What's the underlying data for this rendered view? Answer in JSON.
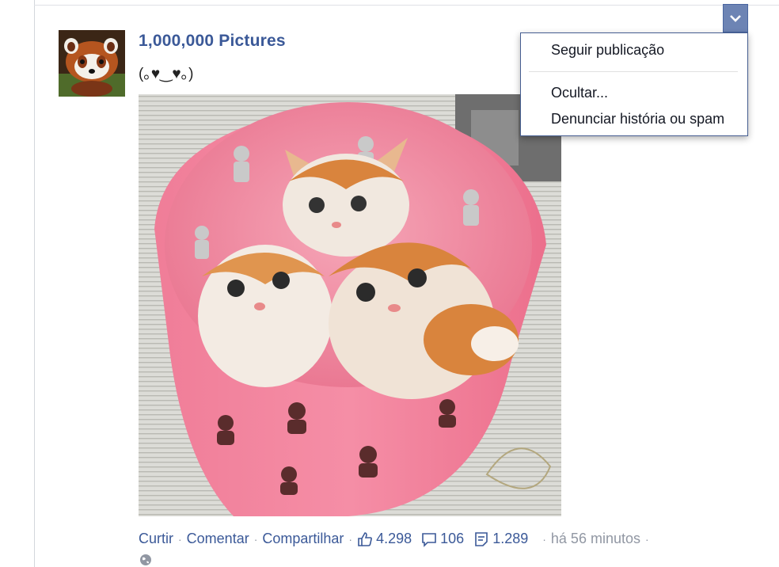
{
  "post": {
    "page_name": "1,000,000 Pictures",
    "text": "(｡♥‿♥｡)"
  },
  "actions": {
    "like": "Curtir",
    "comment": "Comentar",
    "share": "Compartilhar",
    "likes_count": "4.298",
    "comments_count": "106",
    "shares_count": "1.289",
    "time": "há 56 minutos",
    "separator": "·"
  },
  "menu": {
    "follow": "Seguir publicação",
    "hide": "Ocultar...",
    "report": "Denunciar história ou spam"
  },
  "colors": {
    "link_blue": "#3b5998",
    "muted_gray": "#9197a3",
    "button_blue": "#6d84b4"
  }
}
